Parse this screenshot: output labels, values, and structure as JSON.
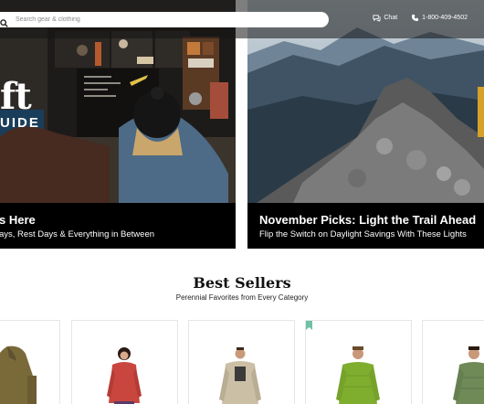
{
  "header": {
    "search_placeholder": "Search gear & clothing",
    "chat_label": "Chat",
    "phone_label": "1-800-409-4502"
  },
  "hero_left": {
    "overlay_title": "ft",
    "overlay_subtitle": "UIDE",
    "title": "s Here",
    "subtitle": "ays, Rest Days & Everything in Between"
  },
  "hero_right": {
    "title": "November Picks: Light the Trail Ahead",
    "subtitle": "Flip the Switch on Daylight Savings With These Lights"
  },
  "best_sellers": {
    "title": "Best Sellers",
    "subtitle": "Perennial Favorites from Every Category"
  },
  "products": [
    {
      "name": "olive fleece jacket",
      "color": "#7a6a3a"
    },
    {
      "name": "red down jacket",
      "color": "#c9463f"
    },
    {
      "name": "tan fleece pullover",
      "color": "#cbbfa6"
    },
    {
      "name": "green puffer jacket",
      "color": "#7fae2f"
    },
    {
      "name": "green quilted jacket",
      "color": "#6f8a57"
    }
  ],
  "colors": {
    "accent_bookmark": "#6fc2a8",
    "header_overlay": "#141414"
  }
}
